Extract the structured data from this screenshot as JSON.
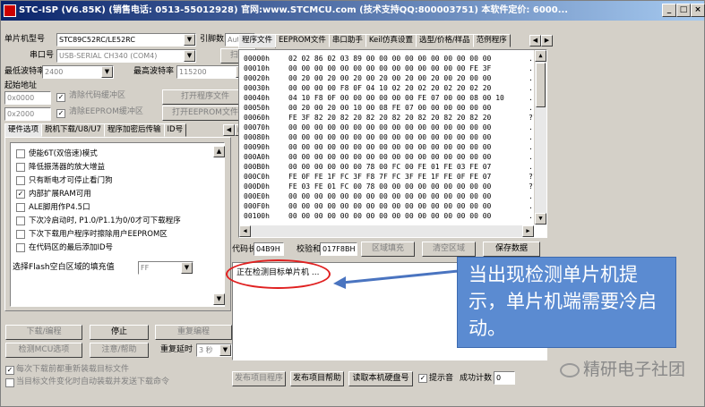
{
  "window": {
    "title": "STC-ISP (V6.85K) (销售电话: 0513-55012928) 官网:www.STCMCU.com  (技术支持QQ:800003751) 本软件定价: 6000...",
    "min_label": "_",
    "max_label": "□",
    "close_label": "×"
  },
  "left": {
    "mcu_label": "单片机型号",
    "mcu_value": "STC89C52RC/LE52RC",
    "pins_label": "引脚数",
    "pins_value": "Auto",
    "port_label": "串口号",
    "port_value": "USB-SERIAL CH340 (COM4)",
    "scan_button": "扫描",
    "min_baud_label": "最低波特率",
    "min_baud_value": "2400",
    "max_baud_label": "最高波特率",
    "max_baud_value": "115200",
    "start_addr_label": "起始地址",
    "addr1": "0x0000",
    "clear_code_label": "清除代码缓冲区",
    "open_program_button": "打开程序文件",
    "addr2": "0x2000",
    "clear_eeprom_label": "清除EEPROM缓冲区",
    "open_eeprom_button": "打开EEPROM文件",
    "tabs": [
      "硬件选项",
      "脱机下载/U8/U7",
      "程序加密后传输",
      "ID号"
    ],
    "options": [
      {
        "label": "使能6T(双倍速)模式",
        "checked": false
      },
      {
        "label": "降低振荡器的放大增益",
        "checked": false
      },
      {
        "label": "只有断电才可停止看门狗",
        "checked": false
      },
      {
        "label": "内部扩展RAM可用",
        "checked": true
      },
      {
        "label": "ALE脚用作P4.5口",
        "checked": false
      },
      {
        "label": "下次冷启动时, P1.0/P1.1为0/0才可下载程序",
        "checked": false
      },
      {
        "label": "下次下载用户程序时擦除用户EEPROM区",
        "checked": false
      },
      {
        "label": "在代码区的最后添加ID号",
        "checked": false
      }
    ],
    "fill_label": "选择Flash空白区域的填充值",
    "fill_value": "FF",
    "download_button": "下载/编程",
    "stop_button": "停止",
    "reprogram_button": "重复编程",
    "check_mcu_button": "检测MCU选项",
    "help_button": "注意/帮助",
    "delay_label": "重复延时",
    "delay_value": "3 秒",
    "bottom_opt1": "每次下载前都重新装载目标文件",
    "bottom_opt2": "当目标文件变化时自动装载并发送下载命令"
  },
  "right": {
    "tabs": [
      "程序文件",
      "EEPROM文件",
      "串口助手",
      "Keil仿真设置",
      "选型/价格/样品",
      "范例程序"
    ],
    "hex_rows": [
      {
        "addr": "00000h",
        "bytes": "02 02 86 02 03 89 00 00 00 00 00 00 00 00 00 00",
        "ascii": "..."
      },
      {
        "addr": "00010h",
        "bytes": "00 00 00 00 00 00 00 00 00 00 00 00 00 00 FE 3F",
        "ascii": ".."
      },
      {
        "addr": "00020h",
        "bytes": "00 20 00 20 00 20 00 20 00 20 00 20 00 20 00 00",
        "ascii": ".."
      },
      {
        "addr": "00030h",
        "bytes": "00 00 00 00 F8 0F 04 10 02 20 02 20 02 20 02 20",
        "ascii": ".."
      },
      {
        "addr": "00040h",
        "bytes": "04 10 F8 0F 00 00 00 00 00 00 FE 07 00 00 08 00 10",
        "ascii": ".."
      },
      {
        "addr": "00050h",
        "bytes": "00 20 00 20 00 10 00 08 FE 07 00 00 00 00 00 00",
        "ascii": ".."
      },
      {
        "addr": "00060h",
        "bytes": "FE 3F 82 20 82 20 82 20 82 20 82 20 82 20 82 20",
        "ascii": "??"
      },
      {
        "addr": "00070h",
        "bytes": "00 00 00 00 00 00 00 00 00 00 00 00 00 00 00 00",
        "ascii": ".."
      },
      {
        "addr": "00080h",
        "bytes": "00 00 00 00 00 00 00 00 00 00 00 00 00 00 00 00",
        "ascii": ".."
      },
      {
        "addr": "00090h",
        "bytes": "00 00 00 00 00 00 00 00 00 00 00 00 00 00 00 00",
        "ascii": ".."
      },
      {
        "addr": "000A0h",
        "bytes": "00 00 00 00 00 00 00 00 00 00 00 00 00 00 00 00",
        "ascii": ".."
      },
      {
        "addr": "000B0h",
        "bytes": "00 00 00 00 00 00 78 00 FC 00 FE 01 FE 03 FE 07",
        "ascii": ".."
      },
      {
        "addr": "000C0h",
        "bytes": "FE 0F FE 1F FC 3F F8 7F FC 3F FE 1F FE 0F FE 07",
        "ascii": "??"
      },
      {
        "addr": "000D0h",
        "bytes": "FE 03 FE 01 FC 00 78 00 00 00 00 00 00 00 00 00",
        "ascii": "??"
      },
      {
        "addr": "000E0h",
        "bytes": "00 00 00 00 00 00 00 00 00 00 00 00 00 00 00 00",
        "ascii": ".."
      },
      {
        "addr": "000F0h",
        "bytes": "00 00 00 00 00 00 00 00 00 00 00 00 00 00 00 00",
        "ascii": ".."
      },
      {
        "addr": "00100h",
        "bytes": "00 00 00 00 00 00 00 00 00 00 00 00 00 00 00 00",
        "ascii": ".."
      }
    ],
    "code_len_label": "代码长度",
    "code_len_value": "04B9H",
    "checksum_label": "校验和",
    "checksum_value": "017F8BH",
    "fill_region_button": "区域填充",
    "clear_region_button": "清空区域",
    "save_button": "保存数据",
    "status_text": "正在检测目标单片机 ...",
    "publish_program_button": "发布项目程序",
    "publish_help_button": "发布项目帮助",
    "read_serial_button": "读取本机硬盘号",
    "sound_label": "提示音",
    "success_label": "成功计数",
    "success_value": "0"
  },
  "annotation": {
    "callout_text": "当出现检测单片机提示，单片机端需要冷启动。",
    "watermark": "精研电子社团"
  },
  "colors": {
    "title_start": "#0a246a",
    "title_end": "#a6caf0",
    "callout_bg": "#5b8bd1",
    "ellipse": "#e02020",
    "arrow": "#4a74c0"
  }
}
